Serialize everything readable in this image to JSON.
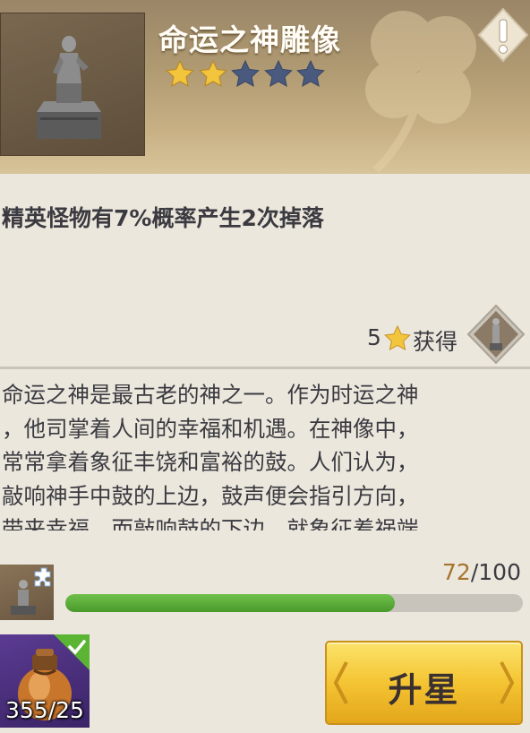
{
  "item": {
    "name": "命运之神雕像",
    "stars_filled": 2,
    "stars_total": 5,
    "effect": "精英怪物有7%概率产生2次掉落"
  },
  "obtain": {
    "star_count": "5",
    "label": "获得"
  },
  "description": "命运之神是最古老的神之一。作为时运之神\n，他司掌着人间的幸福和机遇。在神像中，\n常常拿着象征丰饶和富裕的鼓。人们认为，\n敲响神手中鼓的上边，鼓声便会指引方向，\n带来幸福。而敲响鼓的下边，就象征着祸端",
  "progress": {
    "current": "72",
    "separator": "/",
    "max": "100",
    "fraction": 0.72
  },
  "material": {
    "count": "355/25"
  },
  "upgrade_button": {
    "label": "升星"
  },
  "colors": {
    "star_on": "#f3c53c",
    "star_off": "#4a5a7e",
    "progress_fill": "#5aac38",
    "progress_current": "#a6732c",
    "button": "#f4c433"
  },
  "icons": {
    "warning": "exclamation-icon",
    "star": "star-icon",
    "check": "check-icon",
    "puzzle": "puzzle-icon"
  }
}
